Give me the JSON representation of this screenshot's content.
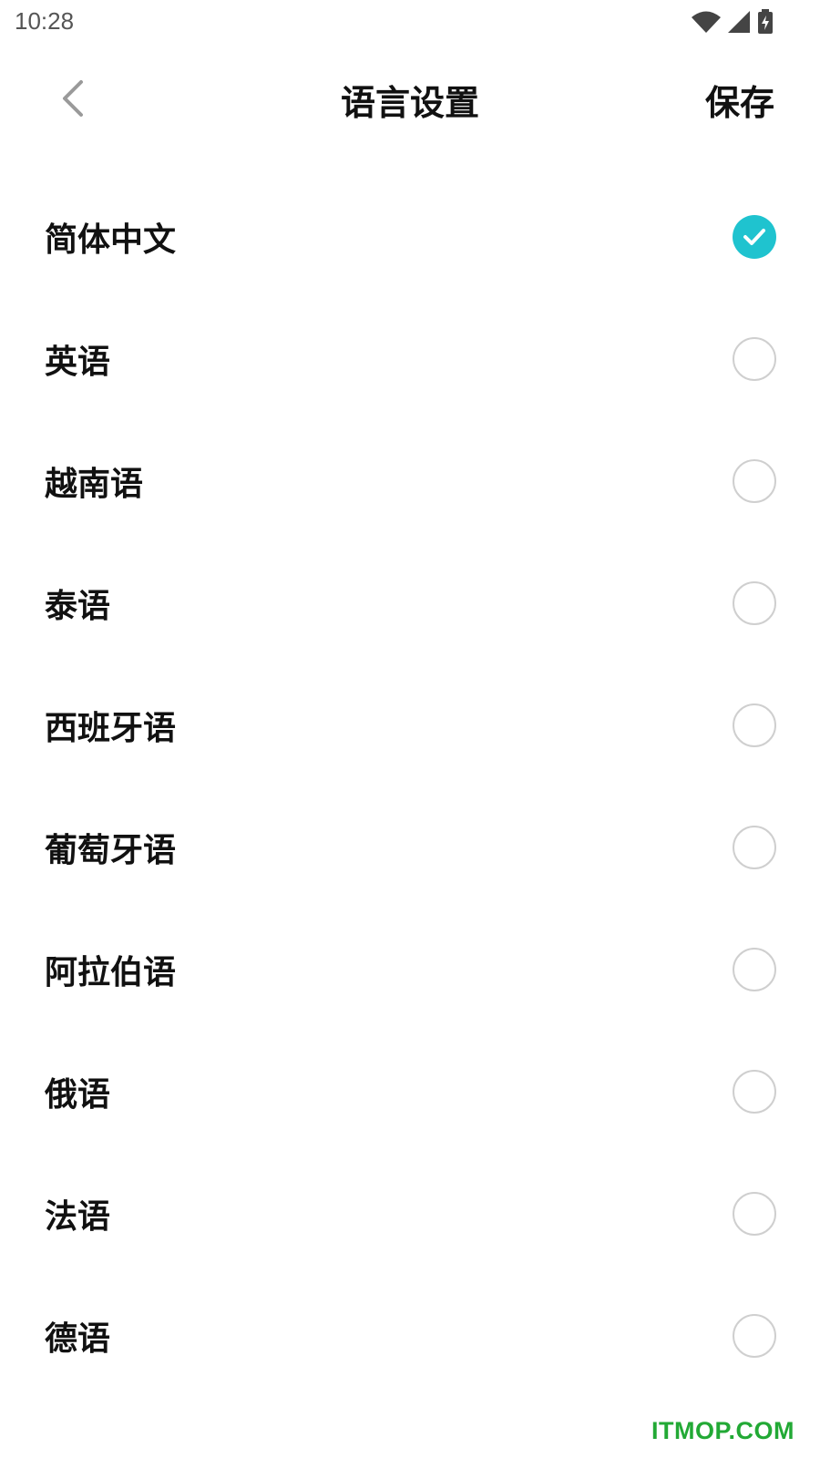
{
  "status_bar": {
    "time": "10:28",
    "icons": [
      "wifi-icon",
      "cell-signal-icon",
      "battery-charging-icon"
    ]
  },
  "header": {
    "back_icon": "chevron-left-icon",
    "title": "语言设置",
    "save_label": "保存"
  },
  "languages": [
    {
      "label": "简体中文",
      "selected": true
    },
    {
      "label": "英语",
      "selected": false
    },
    {
      "label": "越南语",
      "selected": false
    },
    {
      "label": "泰语",
      "selected": false
    },
    {
      "label": "西班牙语",
      "selected": false
    },
    {
      "label": "葡萄牙语",
      "selected": false
    },
    {
      "label": "阿拉伯语",
      "selected": false
    },
    {
      "label": "俄语",
      "selected": false
    },
    {
      "label": "法语",
      "selected": false
    },
    {
      "label": "德语",
      "selected": false
    }
  ],
  "colors": {
    "accent": "#1fc3cf",
    "radio_border": "#cfcfcf",
    "text": "#111111",
    "watermark": "#22a935"
  },
  "watermark": "ITMOP.COM"
}
